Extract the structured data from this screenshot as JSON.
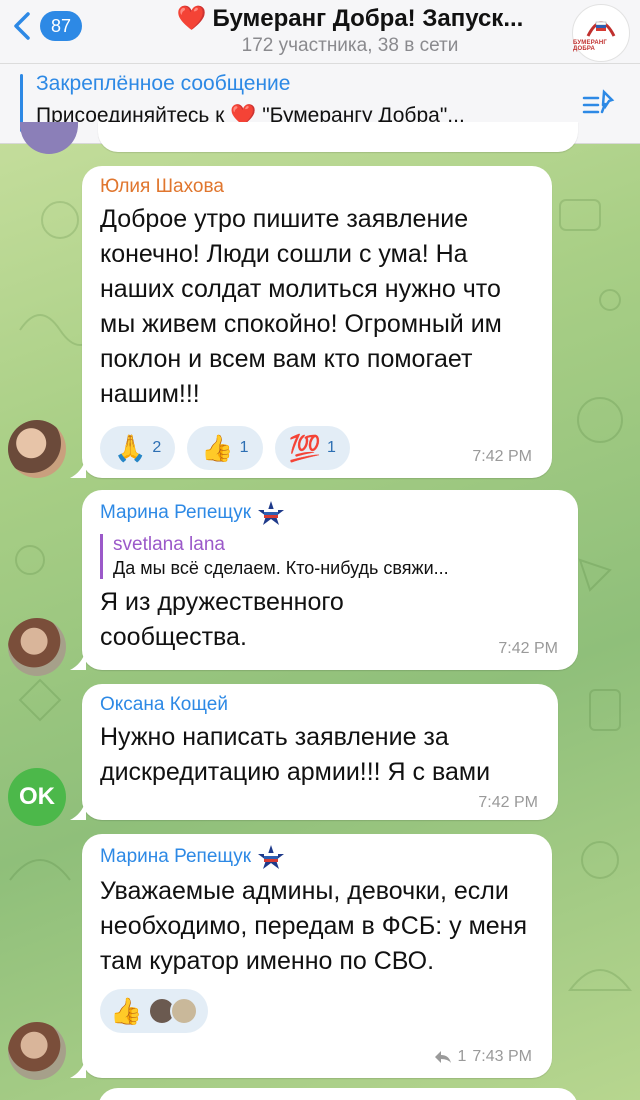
{
  "header": {
    "back_count": "87",
    "title_heart": "❤️",
    "title": "Бумеранг Добра! Запуск...",
    "subtitle": "172 участника, 38 в сети",
    "avatar_logo_text": "БУМЕРАНГ ДОБРА"
  },
  "pinned": {
    "title": "Закреплённое сообщение",
    "text_before": "Присоединяйтесь к",
    "heart": "❤️",
    "text_after": "\"Бумерангу Добра\"..."
  },
  "messages": [
    {
      "sender": "Юлия Шахова",
      "sender_color": "#e0762e",
      "text": "Доброе утро пишите заявление конечно! Люди сошли с ума! На наших солдат молиться нужно что мы живем спокойно! Огромный им поклон и всем вам кто помогает нашим!!!",
      "reactions": [
        {
          "emoji": "🙏",
          "count": "2"
        },
        {
          "emoji": "👍",
          "count": "1"
        },
        {
          "emoji": "💯",
          "count": "1"
        }
      ],
      "time": "7:42 PM"
    },
    {
      "sender": "Марина Репещук",
      "sender_color": "#2d89e5",
      "reply_name": "svetlana lana",
      "reply_text": "Да мы всё сделаем. Кто-нибудь свяжи...",
      "text": "Я из дружественного сообщества.",
      "time": "7:42 PM"
    },
    {
      "sender": "Оксана Кощей",
      "sender_color": "#2d89e5",
      "text": "Нужно написать заявление за дискредитацию армии!!! Я с вами",
      "time": "7:42 PM",
      "avatar_text": "OK"
    },
    {
      "sender": "Марина Репещук",
      "sender_color": "#2d89e5",
      "text": "Уважаемые админы, девочки, если необходимо, передам в ФСБ: у меня там куратор именно по СВО.",
      "reactions": [
        {
          "emoji": "👍"
        }
      ],
      "replies_count": "1",
      "time": "7:43 PM"
    }
  ],
  "colors": {
    "accent": "#2d89e5",
    "bubble": "#ffffff",
    "reply_accent": "#9b59c9"
  }
}
